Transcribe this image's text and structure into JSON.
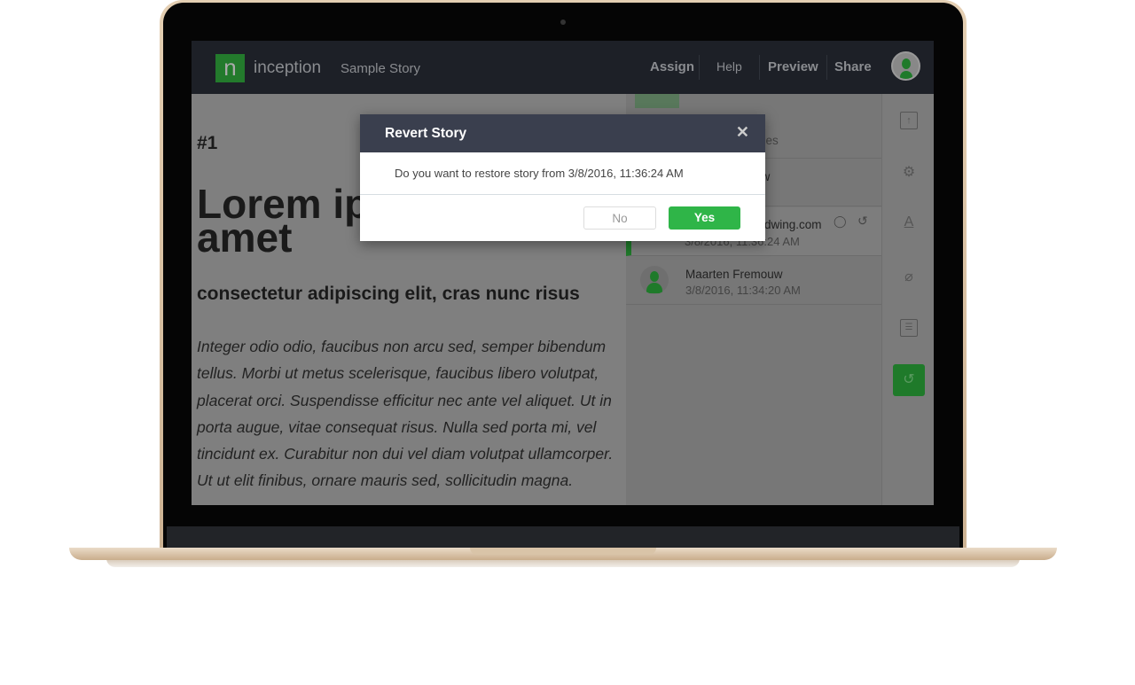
{
  "header": {
    "brand": "inception",
    "logo_glyph": "n",
    "story_title": "Sample Story",
    "nav": [
      "Assign",
      "Help",
      "Preview",
      "Share"
    ]
  },
  "document": {
    "number": "#1",
    "title": "Lorem ip amet",
    "title_line1": "Lorem ip",
    "title_line2": "amet",
    "subtitle": "consectetur adipiscing elit, cras nunc risus",
    "body": "Integer odio odio, faucibus non arcu sed, semper bibendum tellus. Morbi ut metus scelerisque, faucibus libero volutpat, placerat orci. Suspendisse efficitur nec ante vel aliquet. Ut in porta augue, vitae consequat risus. Nulla sed porta mi, vel tincidunt ex. Curabitur non dui vel diam volutpat ullamcorper. Ut ut elit finibus, ornare mauris sed, sollicitudin magna."
  },
  "versions": {
    "subtitle_fragment": "ges",
    "items": [
      {
        "name": "uw",
        "date": ""
      },
      {
        "name": "dwing.com",
        "date": "3/8/2016, 11:36:24 AM",
        "active": true
      },
      {
        "name": "Maarten Fremouw",
        "date": "3/8/2016, 11:34:20 AM"
      }
    ]
  },
  "toolbar_icons": [
    "upload-icon",
    "settings-icon",
    "font-icon",
    "attachment-icon",
    "checklist-icon",
    "history-icon"
  ],
  "modal": {
    "title": "Revert Story",
    "message": "Do you want to restore story from 3/8/2016, 11:36:24 AM",
    "no": "No",
    "yes": "Yes",
    "close": "✕"
  },
  "colors": {
    "accent": "#2fb548",
    "header": "#3a3f4e",
    "appbar": "#1d2027"
  }
}
